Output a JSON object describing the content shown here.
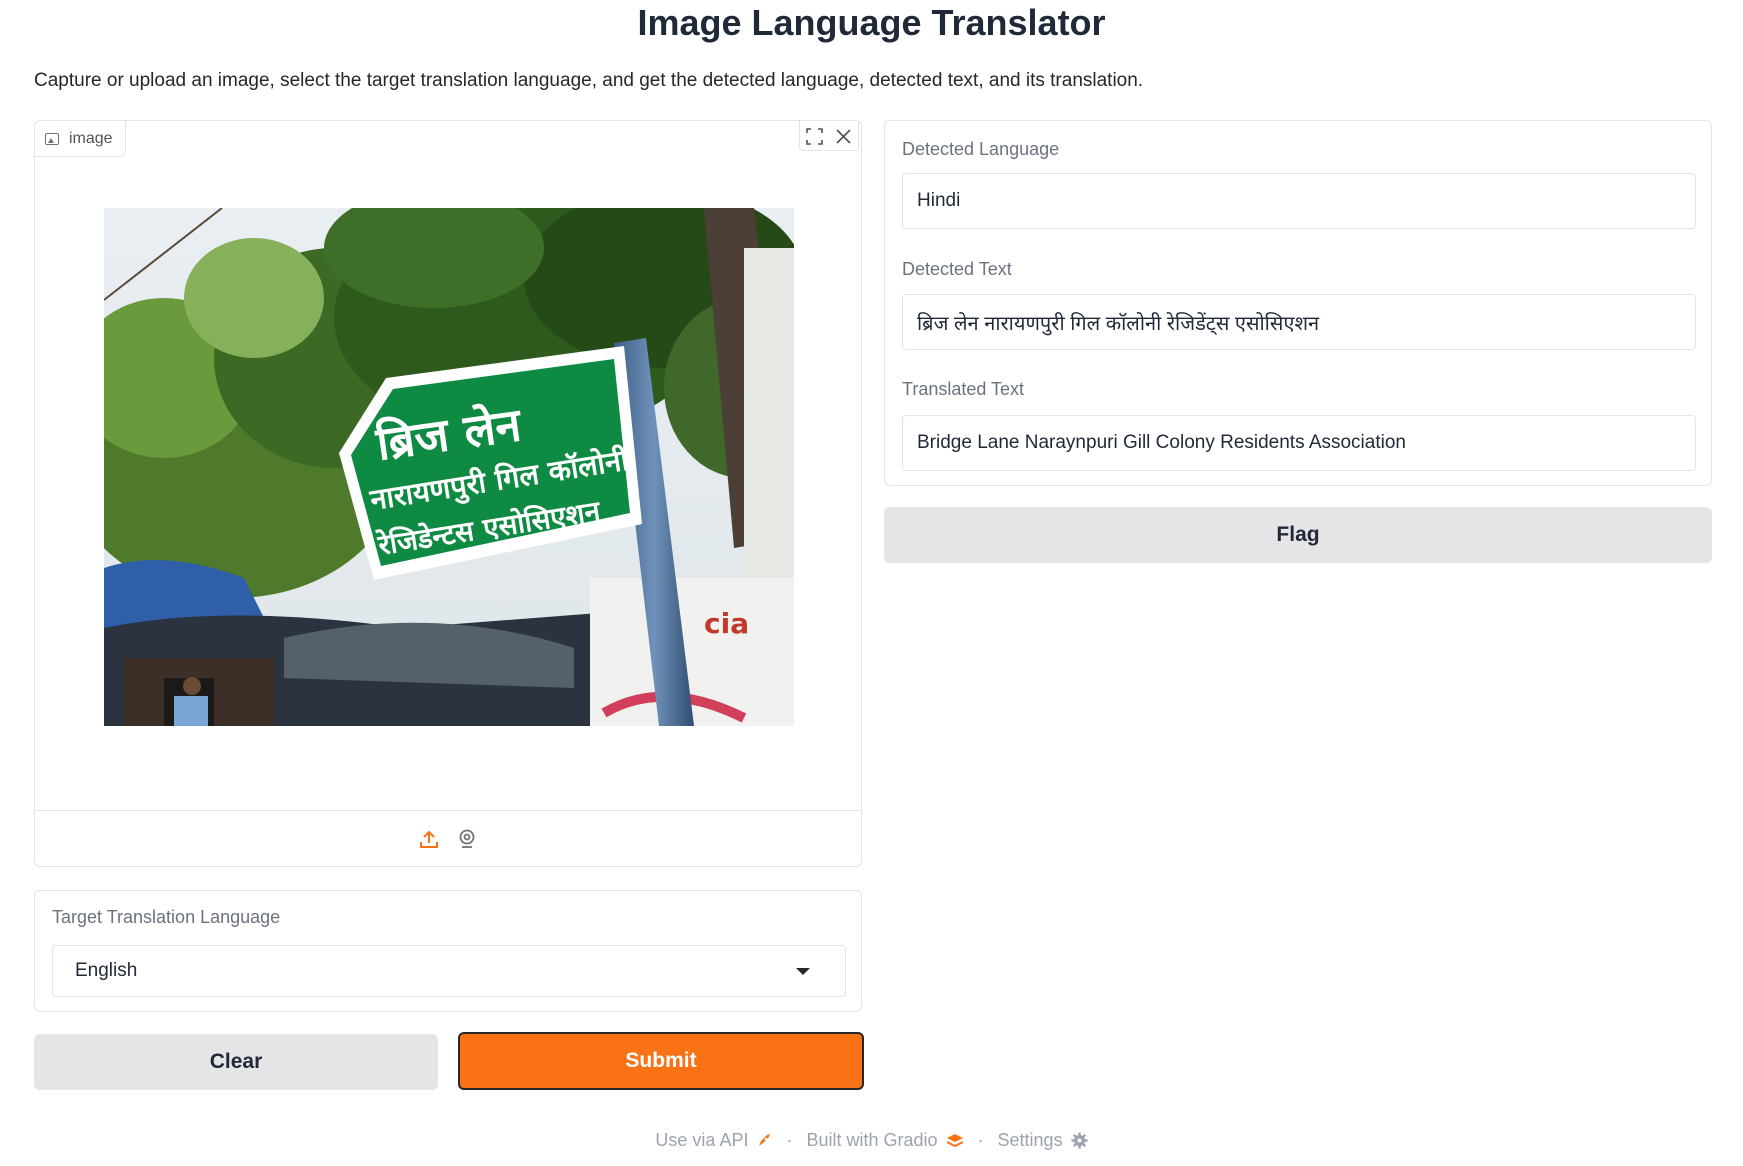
{
  "title": "Image Language Translator",
  "description": "Capture or upload an image, select the target translation language, and get the detected language, detected text, and its translation.",
  "image_input": {
    "label": "image",
    "sign_line1": "ब्रिज लेन",
    "sign_line2": "नारायणपुरी गिल कॉलोनी",
    "sign_line3": "रेजिडेन्टस एसोसिएशन",
    "banner_fragment": "cia"
  },
  "target_language": {
    "label": "Target Translation Language",
    "value": "English"
  },
  "buttons": {
    "clear": "Clear",
    "submit": "Submit",
    "flag": "Flag"
  },
  "outputs": {
    "detected_language_label": "Detected Language",
    "detected_language_value": "Hindi",
    "detected_text_label": "Detected Text",
    "detected_text_value": "ब्रिज लेन नारायणपुरी गिल कॉलोनी रेजिडेंट्स एसोसिएशन",
    "translated_text_label": "Translated Text",
    "translated_text_value": "Bridge Lane Naraynpuri Gill Colony Residents Association"
  },
  "footer": {
    "api": "Use via API",
    "built": "Built with Gradio",
    "settings": "Settings"
  },
  "colors": {
    "accent": "#f97316",
    "sign_green": "#0f8a43",
    "secondary_button": "#e5e5e7"
  }
}
